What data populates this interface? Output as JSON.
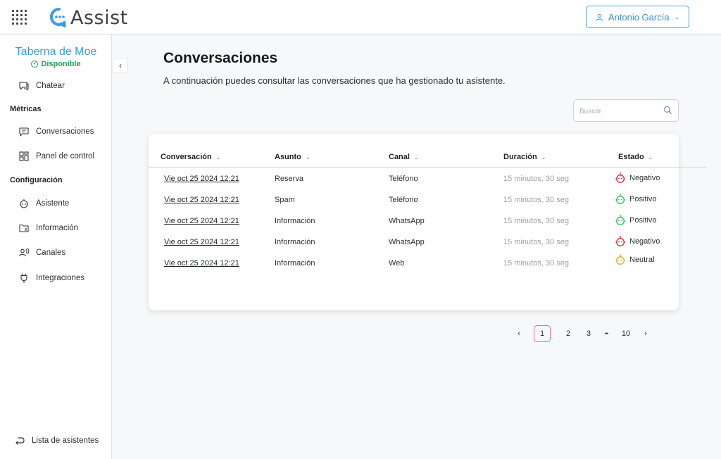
{
  "app": {
    "name": "Assist",
    "user_name": "Antonio García"
  },
  "sidebar": {
    "brand": "Taberna de Moe",
    "status": "Disponible",
    "chat": "Chatear",
    "section_metrics": "Métricas",
    "conversations": "Conversaciones",
    "dashboard": "Panel de control",
    "section_config": "Configuración",
    "assistant": "Asistente",
    "information": "Información",
    "channels": "Canales",
    "integrations": "Integraciones",
    "assistants_list": "Lista de asistentes"
  },
  "main": {
    "title": "Conversaciones",
    "description": "A continuación puedes consultar las conversaciones que ha gestionado tu asistente.",
    "search_placeholder": "Buscar"
  },
  "table": {
    "columns": [
      "Conversación",
      "Asunto",
      "Canal",
      "Duración",
      "Estado"
    ],
    "rows": [
      {
        "conversation": "Vie oct 25 2024 12:21",
        "subject": "Reserva",
        "channel": "Teléfono",
        "duration": "15 minutos, 30 seg",
        "status": "Negativo",
        "status_color": "#e5253c"
      },
      {
        "conversation": "Vie oct 25 2024 12:21",
        "subject": "Spam",
        "channel": "Teléfono",
        "duration": "15 minutos, 30 seg",
        "status": "Positivo",
        "status_color": "#2ec257"
      },
      {
        "conversation": "Vie oct 25 2024 12:21",
        "subject": "Información",
        "channel": "WhatsApp",
        "duration": "15 minutos, 30 seg",
        "status": "Positivo",
        "status_color": "#2ec257"
      },
      {
        "conversation": "Vie oct 25 2024 12:21",
        "subject": "Información",
        "channel": "WhatsApp",
        "duration": "15 minutos, 30 seg",
        "status": "Negativo",
        "status_color": "#e5253c"
      },
      {
        "conversation": "Vie oct 25 2024 12:21",
        "subject": "Información",
        "channel": "Web",
        "duration": "15 minutos, 30 seg",
        "status": "Neutral",
        "status_color": "#f0a81e"
      }
    ]
  },
  "pagination": {
    "prev": "‹",
    "pages": [
      "1",
      "2",
      "3"
    ],
    "ellipsis": "•••",
    "last": "10",
    "next": "›",
    "current": "1"
  },
  "colors": {
    "accent": "#3d9be0",
    "available": "#1fa05a",
    "active_page_border": "#e56b9b"
  }
}
